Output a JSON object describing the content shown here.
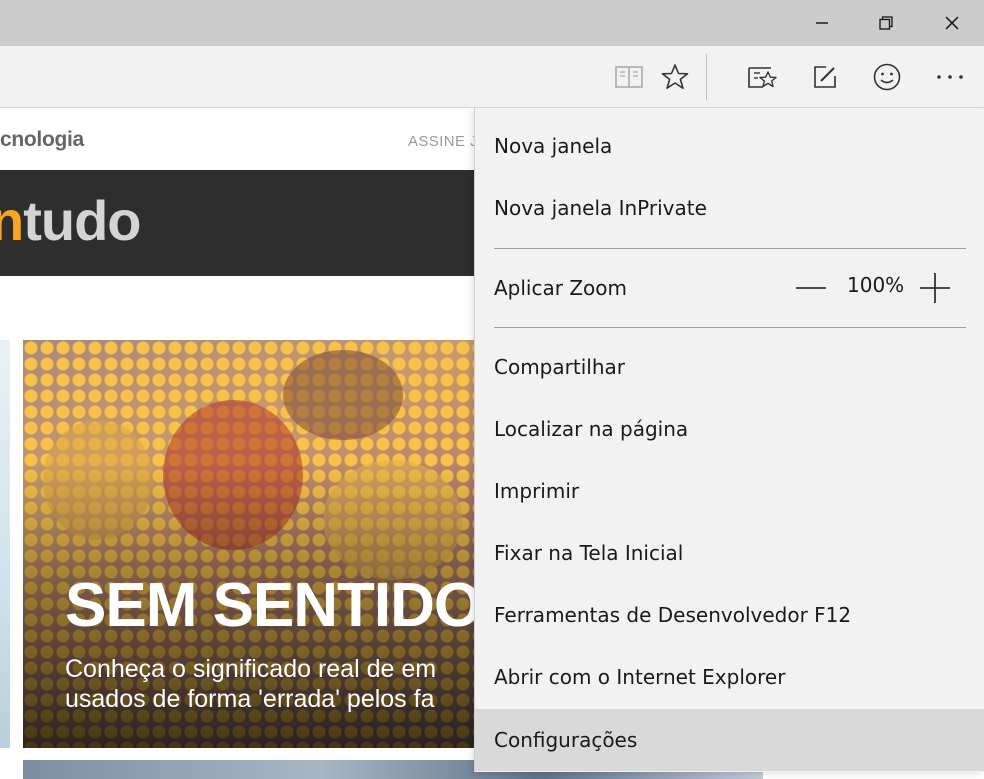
{
  "window": {
    "minimize_icon": "minimize-icon",
    "restore_icon": "restore-icon",
    "close_icon": "close-icon"
  },
  "toolbar": {
    "icons": [
      "reading-view-icon",
      "favorite-star-icon",
      "hub-icon",
      "web-note-icon",
      "feedback-smiley-icon",
      "more-actions-icon"
    ]
  },
  "page": {
    "category": "cnologia",
    "subscribe": "ASSINE J",
    "brand_accent": "n",
    "brand_rest": "tudo",
    "hero_title": "SEM SENTIDO",
    "hero_subtitle_line1": "Conheça o significado real de em",
    "hero_subtitle_line2": "usados de forma 'errada' pelos fa"
  },
  "menu": {
    "items": [
      {
        "label": "Nova janela"
      },
      {
        "label": "Nova janela InPrivate"
      },
      {
        "label": "Aplicar Zoom"
      },
      {
        "label": "Compartilhar"
      },
      {
        "label": "Localizar na página"
      },
      {
        "label": "Imprimir"
      },
      {
        "label": "Fixar na Tela Inicial"
      },
      {
        "label": "Ferramentas de Desenvolvedor F12"
      },
      {
        "label": "Abrir com o Internet Explorer"
      },
      {
        "label": "Configurações"
      }
    ],
    "zoom_value": "100%",
    "highlighted": "Configurações"
  },
  "colors": {
    "titlebar": "#cccccc",
    "toolbar": "#f2f2f2",
    "menu_bg": "#f2f2f2",
    "menu_highlight": "#d9d9d9",
    "brand_accent": "#f5a623"
  }
}
